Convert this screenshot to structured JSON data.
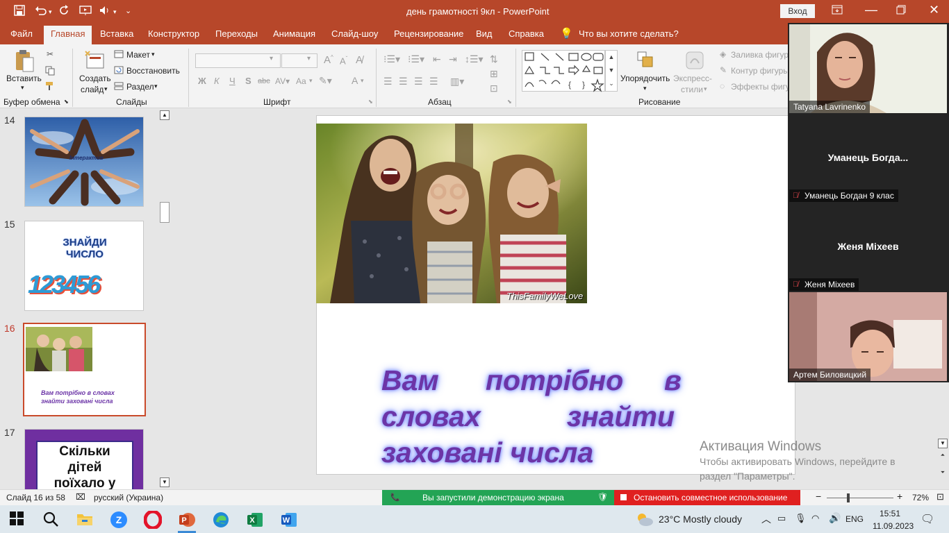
{
  "title_bar": {
    "document_title": "день грамотності 9кл  -  PowerPoint",
    "signin_label": "Вход"
  },
  "tabs": [
    "Файл",
    "Главная",
    "Вставка",
    "Конструктор",
    "Переходы",
    "Анимация",
    "Слайд-шоу",
    "Рецензирование",
    "Вид",
    "Справка"
  ],
  "tell_me": "Что вы хотите сделать?",
  "ribbon": {
    "clipboard": {
      "paste": "Вставить",
      "group": "Буфер обмена"
    },
    "slides": {
      "new_slide_1": "Создать",
      "new_slide_2": "слайд",
      "layout": "Макет",
      "reset": "Восстановить",
      "section": "Раздел",
      "group": "Слайды"
    },
    "font": {
      "group": "Шрифт",
      "bold": "Ж",
      "italic": "К",
      "underline": "Ч",
      "shadow": "S",
      "strike": "abc",
      "case": "Aa",
      "color": "A"
    },
    "paragraph": {
      "group": "Абзац"
    },
    "drawing": {
      "arrange_1": "Упорядочить",
      "quick_1": "Экспресс-",
      "quick_2": "стили",
      "fill": "Заливка фигуры",
      "outline": "Контур фигуры",
      "effects": "Эффекты фигуры",
      "group": "Рисование"
    }
  },
  "thumbnails": [
    {
      "number": "14",
      "caption": "Інтерактив"
    },
    {
      "number": "15",
      "title": "ЗНАЙДИ ЧИСЛО",
      "digits": "123456"
    },
    {
      "number": "16",
      "text": "Вам потрібно в словах знайти заховані числа"
    },
    {
      "number": "17",
      "text_1": "Скільки",
      "text_2": "дітей",
      "text_3": "поїхало у"
    }
  ],
  "slide": {
    "photo_watermark": "ThisFamilyWeLove",
    "line1": [
      "Вам",
      "потрібно",
      "в"
    ],
    "line2": [
      "словах",
      "знайти"
    ],
    "line3": "заховані числа"
  },
  "activation": {
    "title": "Активация Windows",
    "line1": "Чтобы активировать Windows, перейдите в",
    "line2": "раздел \"Параметры\"."
  },
  "participants": [
    {
      "name": "Tatyana Lavrinenko",
      "video": true
    },
    {
      "display": "Уманець  Богда...",
      "name": "Уманець Богдан 9 клас",
      "muted": true
    },
    {
      "display": "Женя Міхеев",
      "name": "Женя Міхеев",
      "muted": true
    },
    {
      "name": "Артем Биловицкий",
      "video": true
    }
  ],
  "status": {
    "slide_info": "Слайд 16 из 58",
    "language": "русский (Украина)",
    "share_notice": "Вы запустили демонстрацию экрана",
    "stop_share": "Остановить совместное использование",
    "zoom": "72%"
  },
  "taskbar": {
    "weather": "23°C  Mostly cloudy",
    "lang": "ENG",
    "time": "15:51",
    "date": "11.09.2023"
  },
  "colors": {
    "accent": "#b7472a",
    "slide_text": "#6c35a7",
    "share_green": "#23a455",
    "stop_red": "#e02020"
  }
}
